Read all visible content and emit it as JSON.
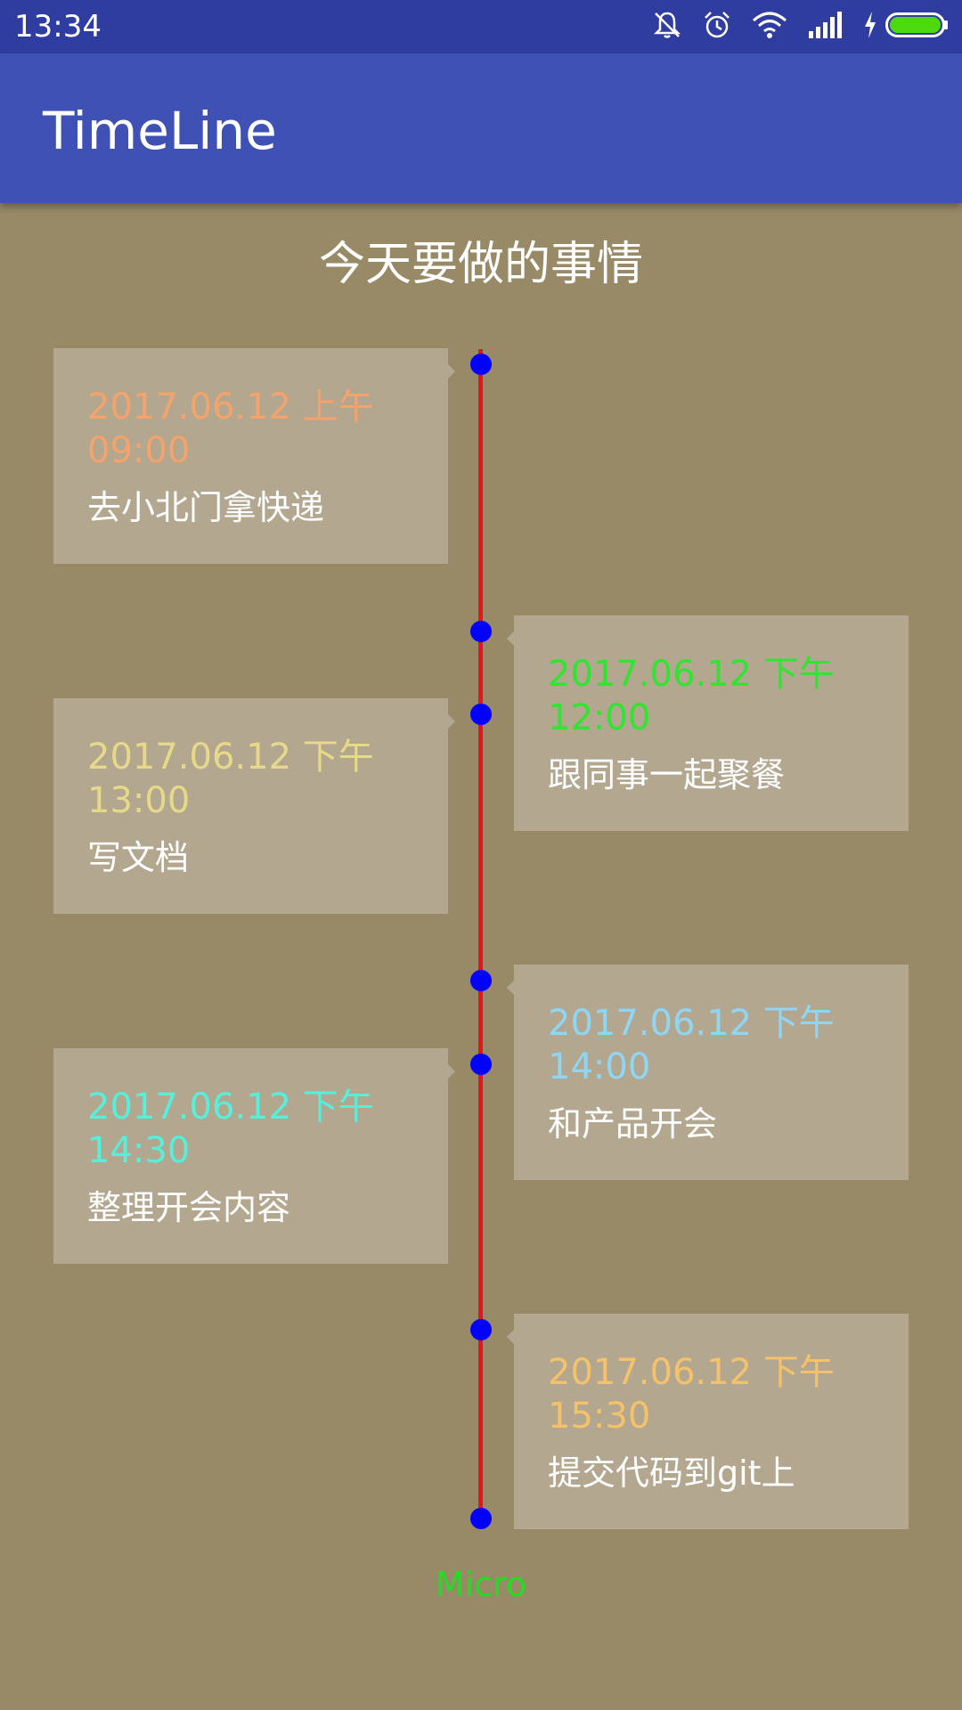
{
  "status_bar": {
    "time": "13:34"
  },
  "app_bar": {
    "title": "TimeLine"
  },
  "heading": "今天要做的事情",
  "events": [
    {
      "time": "2017.06.12 上午 09:00",
      "task": "去小北门拿快递",
      "time_color": "#f3a36b",
      "side": "left"
    },
    {
      "time": "2017.06.12 下午 12:00",
      "task": "跟同事一起聚餐",
      "time_color": "#2fe52f",
      "side": "right"
    },
    {
      "time": "2017.06.12 下午 13:00",
      "task": "写文档",
      "time_color": "#e6d98a",
      "side": "left"
    },
    {
      "time": "2017.06.12 下午 14:00",
      "task": "和产品开会",
      "time_color": "#8fd6f5",
      "side": "right"
    },
    {
      "time": "2017.06.12 下午 14:30",
      "task": "整理开会内容",
      "time_color": "#55f0dc",
      "side": "left"
    },
    {
      "time": "2017.06.12 下午 15:30",
      "task": "提交代码到git上",
      "time_color": "#f5c26b",
      "side": "right"
    }
  ],
  "footer": {
    "label": "Micro",
    "color": "#22dd22"
  },
  "colors": {
    "status_bar": "#2f3da0",
    "app_bar": "#3f51b5",
    "background": "#988a67",
    "card": "#b4a790",
    "line": "#e8141c",
    "dot": "#0000ff"
  }
}
